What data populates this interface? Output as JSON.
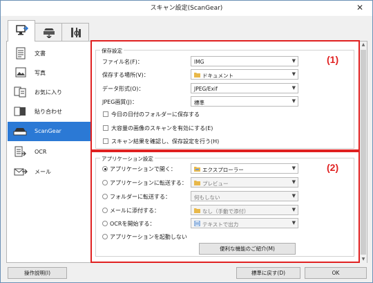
{
  "window": {
    "title": "スキャン設定(ScanGear)",
    "close_glyph": "✕"
  },
  "tabs": [
    {
      "icon": "scan-from-computer-icon"
    },
    {
      "icon": "scan-from-panel-icon"
    },
    {
      "icon": "general-settings-icon"
    }
  ],
  "sidebar": {
    "items": [
      {
        "label": "文書",
        "icon": "document-icon"
      },
      {
        "label": "写真",
        "icon": "photo-icon"
      },
      {
        "label": "お気に入り",
        "icon": "favorites-icon"
      },
      {
        "label": "貼り合わせ",
        "icon": "stitch-icon"
      },
      {
        "label": "ScanGear",
        "icon": "scangear-icon",
        "selected": true
      },
      {
        "label": "OCR",
        "icon": "ocr-icon"
      },
      {
        "label": "メール",
        "icon": "mail-icon"
      }
    ]
  },
  "callouts": {
    "one": "(1)",
    "two": "(2)"
  },
  "save_settings": {
    "title": "保存設定",
    "filename_label": "ファイル名(F)：",
    "filename_value": "IMG",
    "save_in_label": "保存する場所(V)：",
    "save_in_value": "ドキュメント",
    "data_format_label": "データ形式(O)：",
    "data_format_value": "JPEG/Exif",
    "jpeg_quality_label": "JPEG画質(J)：",
    "jpeg_quality_value": "標準",
    "subfolder_label": "今日の日付のフォルダーに保存する",
    "large_images_label": "大容量の画像のスキャンを有効にする(E)",
    "confirm_label": "スキャン結果を確認し、保存設定を行う(H)"
  },
  "app_settings": {
    "title": "アプリケーション設定",
    "open_with_label": "アプリケーションで開く：",
    "open_with_value": "エクスプローラー",
    "send_to_app_label": "アプリケーションに転送する：",
    "send_to_app_value": "プレビュー",
    "send_to_folder_label": "フォルダーに転送する：",
    "send_to_folder_value": "何もしない",
    "attach_email_label": "メールに添付する：",
    "attach_email_value": "なし（手動で添付）",
    "start_ocr_label": "OCRを開始する：",
    "start_ocr_value": "テキストで出力",
    "no_app_label": "アプリケーションを起動しない",
    "more_functions_button": "便利な機能のご紹介(M)",
    "selected_option": "open_with"
  },
  "footer": {
    "instructions_button": "操作説明(I)",
    "defaults_button": "標準に戻す(D)",
    "ok_button": "OK"
  }
}
